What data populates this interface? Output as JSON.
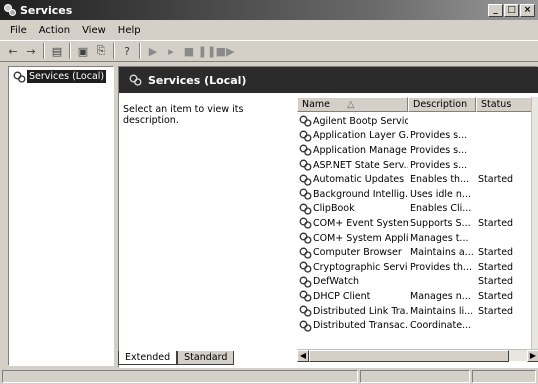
{
  "window": {
    "title": "Services"
  },
  "menubar": {
    "items": [
      "File",
      "Action",
      "View",
      "Help"
    ]
  },
  "toolbar": {
    "buttons": [
      "back-arrow",
      "forward-arrow",
      "show-hide-console-tree",
      "properties",
      "export-list",
      "help",
      "start",
      "play",
      "stop",
      "pause",
      "restart"
    ]
  },
  "tree": {
    "root_label": "Services (Local)"
  },
  "pane": {
    "header_title": "Services (Local)",
    "description_hint": "Select an item to view its description."
  },
  "list": {
    "columns": [
      "Name",
      "Description",
      "Status"
    ],
    "rows": [
      {
        "name": "Agilent Bootp Service",
        "desc": "",
        "status": ""
      },
      {
        "name": "Application Layer G...",
        "desc": "Provides s...",
        "status": ""
      },
      {
        "name": "Application Manage...",
        "desc": "Provides s...",
        "status": ""
      },
      {
        "name": "ASP.NET State Serv...",
        "desc": "Provides s...",
        "status": ""
      },
      {
        "name": "Automatic Updates",
        "desc": "Enables th...",
        "status": "Started"
      },
      {
        "name": "Background Intellig...",
        "desc": "Uses idle n...",
        "status": ""
      },
      {
        "name": "ClipBook",
        "desc": "Enables Cli...",
        "status": ""
      },
      {
        "name": "COM+ Event System",
        "desc": "Supports S...",
        "status": "Started"
      },
      {
        "name": "COM+ System Appli...",
        "desc": "Manages t...",
        "status": ""
      },
      {
        "name": "Computer Browser",
        "desc": "Maintains a...",
        "status": "Started"
      },
      {
        "name": "Cryptographic Servi...",
        "desc": "Provides th...",
        "status": "Started"
      },
      {
        "name": "DefWatch",
        "desc": "",
        "status": "Started"
      },
      {
        "name": "DHCP Client",
        "desc": "Manages n...",
        "status": "Started"
      },
      {
        "name": "Distributed Link Tra...",
        "desc": "Maintains li...",
        "status": "Started"
      },
      {
        "name": "Distributed Transac...",
        "desc": "Coordinate...",
        "status": ""
      }
    ]
  },
  "tabs": [
    "Extended",
    "Standard"
  ]
}
